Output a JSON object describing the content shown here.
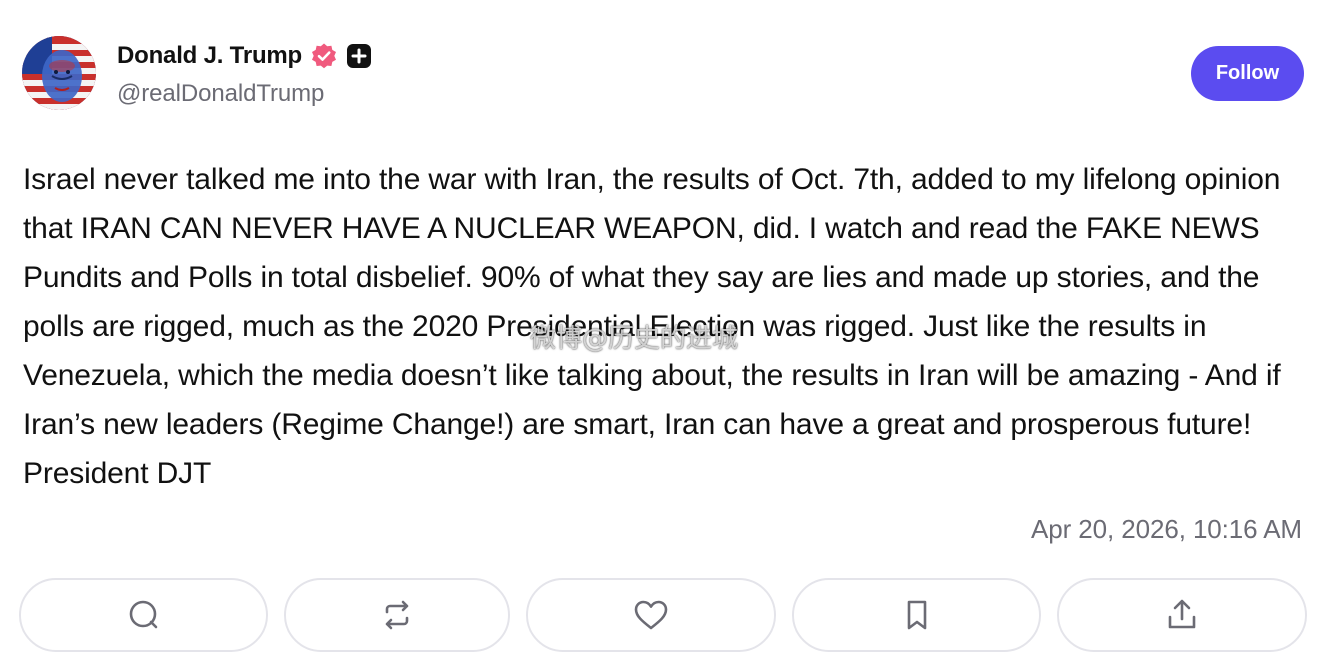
{
  "header": {
    "display_name": "Donald J. Trump",
    "handle": "@realDonaldTrump",
    "follow_label": "Follow",
    "verified_icon": "verified-badge-icon",
    "plus_icon": "plus-badge-icon",
    "accent_color": "#5b4cf0",
    "verified_color": "#f05a7e"
  },
  "post": {
    "text": "Israel never talked me into the war with Iran, the results of Oct. 7th, added to my lifelong opinion that IRAN CAN NEVER HAVE A NUCLEAR WEAPON, did. I watch and read the FAKE NEWS Pundits and Polls in total disbelief. 90% of what they say are lies and made up stories, and the polls are rigged, much as the 2020 Presidential Election was rigged. Just like the results in Venezuela, which the media doesn’t like talking about, the results in Iran will be amazing - And if Iran’s new leaders (Regime Change!) are smart, Iran can have a great and prosperous future! President DJT",
    "timestamp": "Apr 20, 2026, 10:16 AM",
    "watermark": "微博@历史的进城"
  },
  "actions": [
    {
      "name": "reply",
      "icon": "reply-icon"
    },
    {
      "name": "retruth",
      "icon": "repost-icon"
    },
    {
      "name": "like",
      "icon": "heart-icon"
    },
    {
      "name": "bookmark",
      "icon": "bookmark-icon"
    },
    {
      "name": "share",
      "icon": "share-icon"
    }
  ]
}
